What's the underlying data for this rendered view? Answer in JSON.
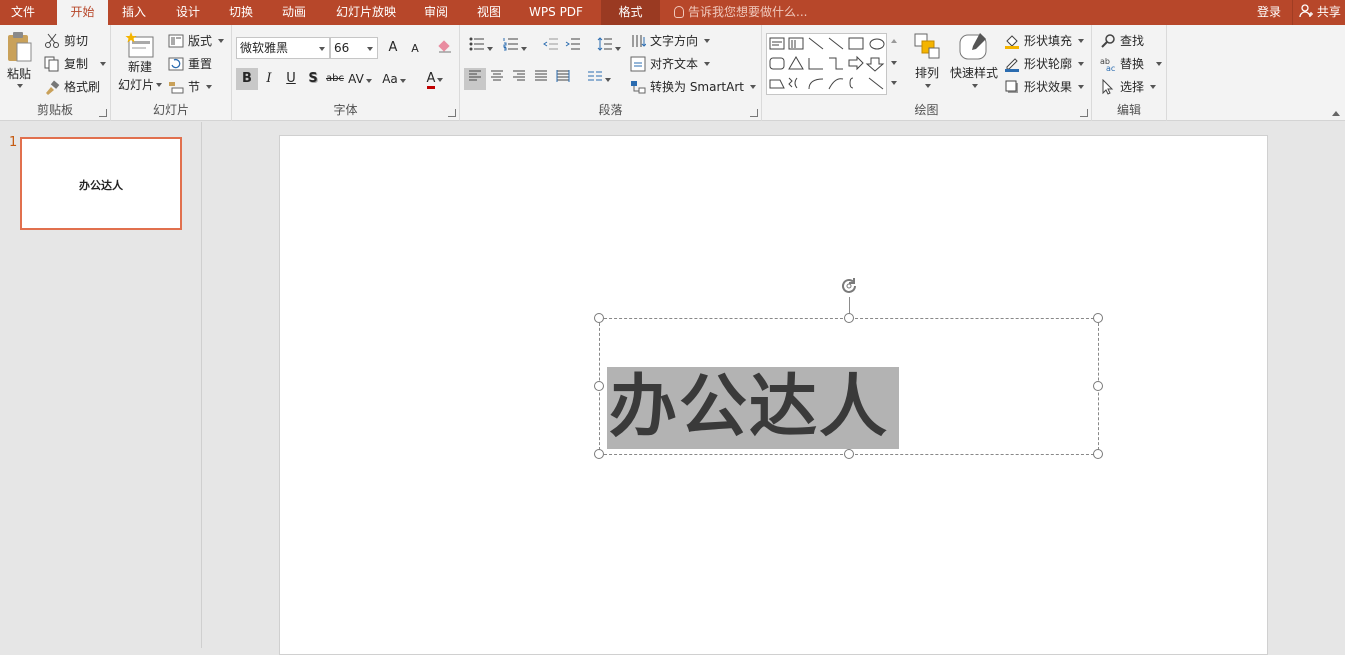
{
  "tabs": [
    {
      "label": "文件"
    },
    {
      "label": "开始"
    },
    {
      "label": "插入"
    },
    {
      "label": "设计"
    },
    {
      "label": "切换"
    },
    {
      "label": "动画"
    },
    {
      "label": "幻灯片放映"
    },
    {
      "label": "审阅"
    },
    {
      "label": "视图"
    },
    {
      "label": "WPS PDF"
    },
    {
      "label": "格式"
    }
  ],
  "tell_me": "告诉我您想要做什么...",
  "login": "登录",
  "share": "共享",
  "groups": {
    "clipboard": {
      "label": "剪贴板",
      "paste": "粘贴",
      "cut": "剪切",
      "copy": "复制",
      "format_painter": "格式刷"
    },
    "slides": {
      "label": "幻灯片",
      "new_slide_line1": "新建",
      "new_slide_line2": "幻灯片",
      "layout": "版式",
      "reset": "重置",
      "section": "节"
    },
    "font": {
      "label": "字体",
      "font_name": "微软雅黑",
      "font_size": "66",
      "grow": "A",
      "shrink": "A",
      "bold": "B",
      "italic": "I",
      "underline": "U",
      "shadow": "S",
      "strike": "abc",
      "spacing": "AV",
      "case": "Aa",
      "color": "A"
    },
    "paragraph": {
      "label": "段落",
      "text_direction": "文字方向",
      "align_text": "对齐文本",
      "smartart": "转换为 SmartArt"
    },
    "drawing": {
      "label": "绘图",
      "arrange": "排列",
      "quick_styles": "快速样式",
      "shape_fill": "形状填充",
      "shape_outline": "形状轮廓",
      "shape_effects": "形状效果"
    },
    "editing": {
      "label": "编辑",
      "find": "查找",
      "replace": "替换",
      "select": "选择"
    }
  },
  "slides_pane": {
    "slide_number": "1",
    "thumb_text": "办公达人"
  },
  "slide": {
    "text": "办公达人"
  },
  "colors": {
    "accent": "#b7472a",
    "selection": "#b3b3b3",
    "thumb_border": "#e1704e"
  }
}
